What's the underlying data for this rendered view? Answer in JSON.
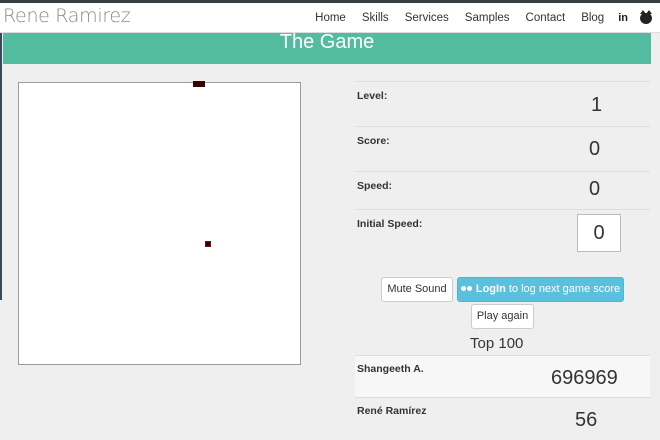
{
  "brand": "Rene Ramirez",
  "nav": {
    "links": [
      "Home",
      "Skills",
      "Services",
      "Samples",
      "Contact",
      "Blog"
    ],
    "icons": [
      "linkedin-icon",
      "github-icon"
    ],
    "linkedin_glyph": "in"
  },
  "page_title": "The Game",
  "game": {
    "level_label": "Level:",
    "level": "1",
    "score_label": "Score:",
    "score": "0",
    "speed_label": "Speed:",
    "speed": "0",
    "initial_speed_label": "Initial Speed:",
    "initial_speed": "0"
  },
  "buttons": {
    "mute": "Mute Sound",
    "login_bold": "LogIn",
    "login_rest": " to log next game score",
    "play_again": "Play again"
  },
  "leaderboard": {
    "title": "Top 100",
    "entries": [
      {
        "name": "Shangeeth A.",
        "score": "696969"
      },
      {
        "name": "René Ramírez",
        "score": "56"
      }
    ]
  },
  "colors": {
    "banner": "#52bba0",
    "login_button": "#5bc0de",
    "snake": "#3a0000"
  }
}
